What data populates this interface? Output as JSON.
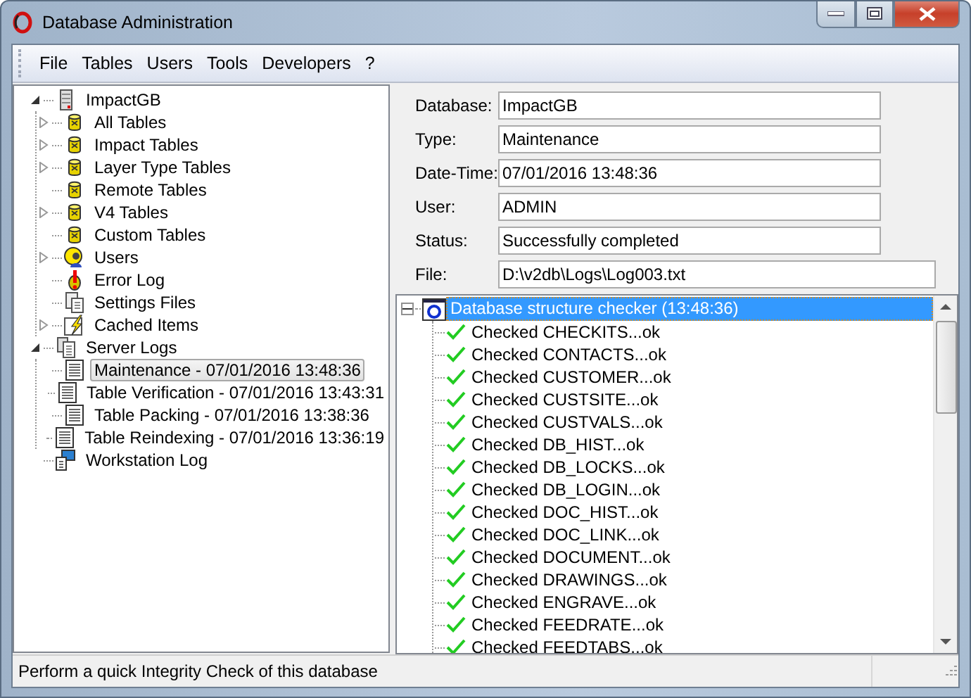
{
  "window": {
    "title": "Database Administration"
  },
  "menu": [
    "File",
    "Tables",
    "Users",
    "Tools",
    "Developers",
    "?"
  ],
  "tree": [
    {
      "label": "ImpactGB",
      "kind": "server",
      "expanded": true,
      "selected": false,
      "children": [
        {
          "label": "All Tables",
          "kind": "database",
          "expanded": false,
          "selected": false
        },
        {
          "label": "Impact Tables",
          "kind": "database",
          "expanded": false,
          "selected": false
        },
        {
          "label": "Layer Type Tables",
          "kind": "database",
          "expanded": false,
          "selected": false
        },
        {
          "label": "Remote Tables",
          "kind": "database",
          "selected": false
        },
        {
          "label": "V4 Tables",
          "kind": "database",
          "expanded": false,
          "selected": false
        },
        {
          "label": "Custom Tables",
          "kind": "database",
          "selected": false
        },
        {
          "label": "Users",
          "kind": "users",
          "expanded": false,
          "selected": false
        },
        {
          "label": "Error Log",
          "kind": "error",
          "selected": false
        },
        {
          "label": "Settings Files",
          "kind": "files",
          "selected": false
        },
        {
          "label": "Cached Items",
          "kind": "cached",
          "expanded": false,
          "selected": false
        }
      ]
    },
    {
      "label": "Server Logs",
      "kind": "logs",
      "expanded": true,
      "selected": false,
      "children": [
        {
          "label": "Maintenance - 07/01/2016 13:48:36",
          "kind": "log",
          "selected": true
        },
        {
          "label": "Table Verification - 07/01/2016 13:43:31",
          "kind": "log",
          "selected": false
        },
        {
          "label": "Table Packing - 07/01/2016 13:38:36",
          "kind": "log",
          "selected": false
        },
        {
          "label": "Table Reindexing - 07/01/2016 13:36:19",
          "kind": "log",
          "selected": false
        }
      ]
    },
    {
      "label": "Workstation Log",
      "kind": "workstation",
      "selected": false
    }
  ],
  "details": [
    {
      "label": "Database:",
      "value": "ImpactGB",
      "wide": false
    },
    {
      "label": "Type:",
      "value": "Maintenance",
      "wide": false
    },
    {
      "label": "Date-Time:",
      "value": "07/01/2016 13:48:36",
      "wide": false
    },
    {
      "label": "User:",
      "value": "ADMIN",
      "wide": false
    },
    {
      "label": "Status:",
      "value": "Successfully completed",
      "wide": false
    },
    {
      "label": "File:",
      "value": "D:\\v2db\\Logs\\Log003.txt",
      "wide": true
    }
  ],
  "log": {
    "title": "Database structure checker (13:48:36)",
    "expanded": true,
    "selected": true,
    "entries": [
      "Checked CHECKITS...ok",
      "Checked CONTACTS...ok",
      "Checked CUSTOMER...ok",
      "Checked CUSTSITE...ok",
      "Checked CUSTVALS...ok",
      "Checked DB_HIST...ok",
      "Checked DB_LOCKS...ok",
      "Checked DB_LOGIN...ok",
      "Checked DOC_HIST...ok",
      "Checked DOC_LINK...ok",
      "Checked DOCUMENT...ok",
      "Checked DRAWINGS...ok",
      "Checked ENGRAVE...ok",
      "Checked FEEDRATE...ok",
      "Checked FEEDTABS...ok"
    ]
  },
  "status_bar": "Perform a quick Integrity Check of this database"
}
